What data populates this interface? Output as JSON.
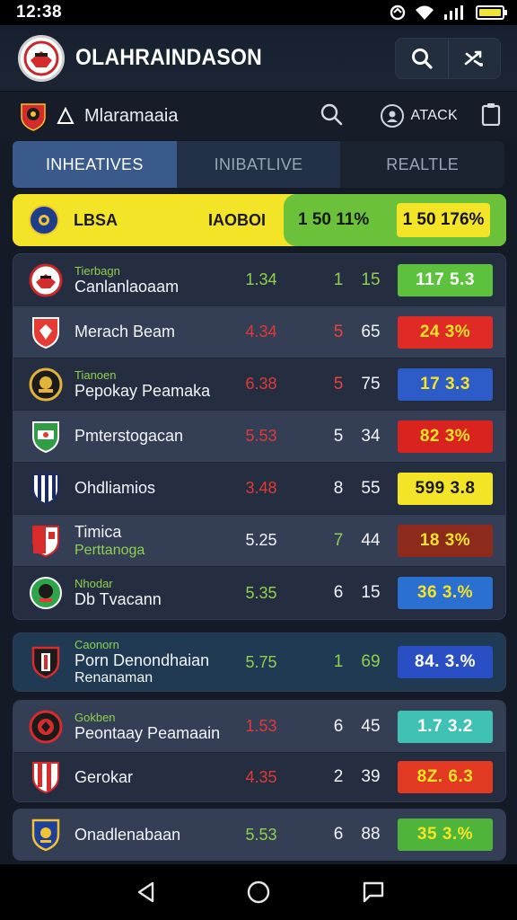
{
  "status_bar": {
    "time": "12:38"
  },
  "header": {
    "title": "OLAHRAINDASON",
    "icons": [
      "search-icon",
      "shuffle-icon"
    ]
  },
  "sub_header": {
    "title": "Mlaramaaia",
    "account_label": "ATACK"
  },
  "tabs": [
    {
      "label": "INHEATIVES",
      "active": true
    },
    {
      "label": "INIBATLIVE",
      "active": false
    },
    {
      "label": "REALTLE",
      "active": false
    }
  ],
  "highlight": {
    "name": "LBSA",
    "code": "IAOBOI",
    "mid_value": "1 50 11%",
    "box_value": "1 50 176%"
  },
  "groups": [
    {
      "rows": [
        {
          "tag": "Tierbagn",
          "name": "Canlanlaoaam",
          "odds": "1.34",
          "odds_color": "green",
          "n1": "1",
          "n1_color": "green",
          "n2": "15",
          "n2_color": "green",
          "pct": "117 5.3",
          "pct_bg": "#5cc23e",
          "pct_fg": "#ffffff",
          "crest": "red-round"
        },
        {
          "tag": "",
          "name": "Merach Beam",
          "odds": "4.34",
          "odds_color": "red",
          "n1": "5",
          "n1_color": "red",
          "n2": "65",
          "n2_color": "white",
          "pct": "24 3%",
          "pct_bg": "#e02a26",
          "pct_fg": "#f4e428",
          "crest": "red-shield"
        },
        {
          "tag": "Tianoen",
          "name": "Pepokay Peamaka",
          "odds": "6.38",
          "odds_color": "red",
          "n1": "5",
          "n1_color": "red",
          "n2": "75",
          "n2_color": "white",
          "pct": "17 3.3",
          "pct_bg": "#2d5cc8",
          "pct_fg": "#f4e428",
          "crest": "gold-round"
        },
        {
          "tag": "",
          "name": "Pmterstogacan",
          "odds": "5.53",
          "odds_color": "red",
          "n1": "5",
          "n1_color": "white",
          "n2": "34",
          "n2_color": "white",
          "pct": "82 3%",
          "pct_bg": "#d8231f",
          "pct_fg": "#f4e428",
          "crest": "green-shield"
        },
        {
          "tag": "",
          "name": "Ohdliamios",
          "odds": "3.48",
          "odds_color": "red",
          "n1": "8",
          "n1_color": "white",
          "n2": "55",
          "n2_color": "white",
          "pct": "599 3.8",
          "pct_bg": "#f4e428",
          "pct_fg": "#1a1a1a",
          "crest": "striped-shield"
        },
        {
          "tag": "",
          "name": "Timica",
          "sub": "Perttanoga",
          "odds": "5.25",
          "odds_color": "white",
          "n1": "7",
          "n1_color": "green",
          "n2": "44",
          "n2_color": "white",
          "pct": "18 3%",
          "pct_bg": "#8c2a1c",
          "pct_fg": "#f4e428",
          "crest": "red-white-shield"
        },
        {
          "tag": "Nhodar",
          "name": "Db Tvacann",
          "odds": "5.35",
          "odds_color": "green",
          "n1": "6",
          "n1_color": "white",
          "n2": "15",
          "n2_color": "white",
          "pct": "36 3.%",
          "pct_bg": "#2b6fd0",
          "pct_fg": "#f4e428",
          "crest": "green-round"
        }
      ]
    },
    {
      "rows": [
        {
          "tag": "Caonorn",
          "name": "Porn Denondhaian",
          "extra": "Renanaman",
          "odds": "5.75",
          "odds_color": "green",
          "n1": "1",
          "n1_color": "green",
          "n2": "69",
          "n2_color": "green",
          "pct": "84. 3.%",
          "pct_bg": "#2a4fc4",
          "pct_fg": "#ffffff",
          "crest": "black-red-shield"
        }
      ]
    },
    {
      "rows": [
        {
          "tag": "Gokben",
          "name": "Peontaay Peamaain",
          "odds": "1.53",
          "odds_color": "red",
          "n1": "6",
          "n1_color": "white",
          "n2": "45",
          "n2_color": "white",
          "pct": "1.7 3.2",
          "pct_bg": "#3fc2b4",
          "pct_fg": "#ffffff",
          "crest": "red-round-dark"
        },
        {
          "tag": "",
          "name": "Gerokar",
          "odds": "4.35",
          "odds_color": "red",
          "n1": "2",
          "n1_color": "white",
          "n2": "39",
          "n2_color": "white",
          "pct": "8Z. 6.3",
          "pct_bg": "#e23a22",
          "pct_fg": "#f4e428",
          "crest": "red-stripe-shield"
        }
      ]
    },
    {
      "rows": [
        {
          "tag": "",
          "name": "Onadlenabaan",
          "odds": "5.53",
          "odds_color": "green",
          "n1": "6",
          "n1_color": "white",
          "n2": "88",
          "n2_color": "white",
          "pct": "35 3.%",
          "pct_bg": "#4fb53a",
          "pct_fg": "#f4e428",
          "crest": "blue-gold-shield"
        }
      ]
    }
  ],
  "nav_bar": {
    "icons": [
      "back-icon",
      "home-icon",
      "recents-icon"
    ]
  }
}
